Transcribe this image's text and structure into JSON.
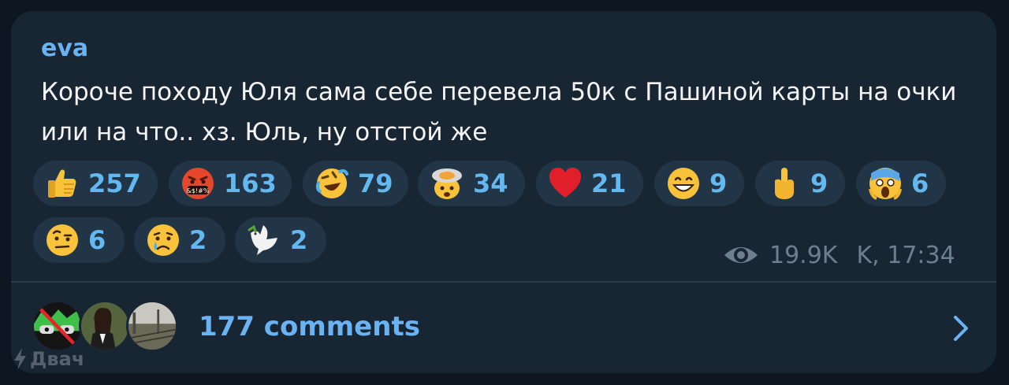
{
  "post": {
    "author": "eva",
    "text": "Короче походу Юля сама себе перевела 50к с Пашиной карты на очки или на что.. хз. Юль, ну отстой же"
  },
  "reactions": [
    {
      "icon": "thumbs-up-icon",
      "count": "257"
    },
    {
      "icon": "cursing-face-icon",
      "count": "163"
    },
    {
      "icon": "rofl-icon",
      "count": "79"
    },
    {
      "icon": "exploding-head-icon",
      "count": "34"
    },
    {
      "icon": "red-heart-icon",
      "count": "21"
    },
    {
      "icon": "grinning-face-icon",
      "count": "9"
    },
    {
      "icon": "middle-finger-icon",
      "count": "9"
    },
    {
      "icon": "screaming-face-icon",
      "count": "6"
    },
    {
      "icon": "raised-eyebrow-face-icon",
      "count": "6"
    },
    {
      "icon": "crying-face-icon",
      "count": "2"
    },
    {
      "icon": "dove-icon",
      "count": "2"
    }
  ],
  "meta": {
    "views": "19.9K",
    "time": "K, 17:34"
  },
  "comments": {
    "label": "177 comments"
  },
  "watermark": "Двач",
  "colors": {
    "background": "#0e1621",
    "bubble": "#182533",
    "accent": "#6ab3f3",
    "reaction_bg": "#223546",
    "meta": "#6d7f8f"
  }
}
